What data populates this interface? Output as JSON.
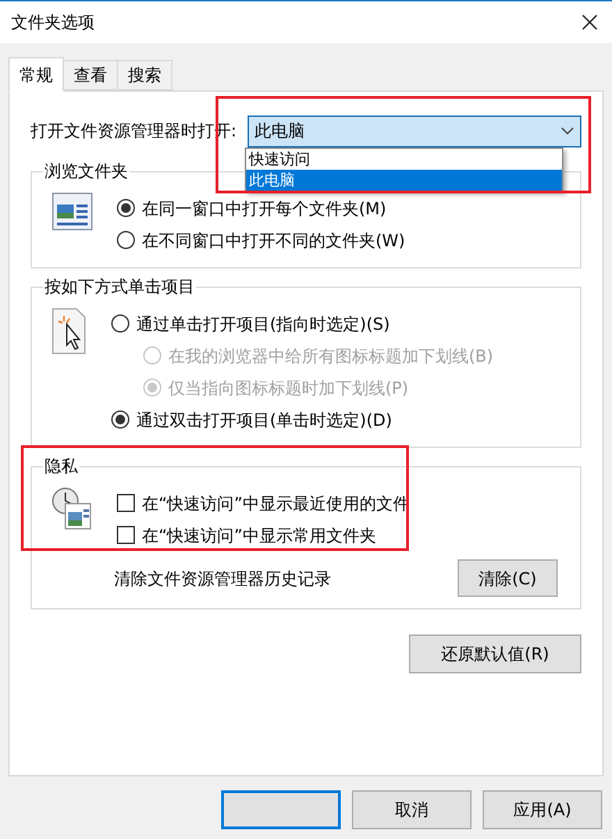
{
  "window": {
    "title": "文件夹选项"
  },
  "tabs": [
    {
      "label": "常规",
      "selected": true
    },
    {
      "label": "查看",
      "selected": false
    },
    {
      "label": "搜索",
      "selected": false
    }
  ],
  "open_in": {
    "label": "打开文件资源管理器时打开:",
    "value": "此电脑",
    "expanded": true,
    "highlighted": true,
    "options": [
      {
        "label": "快速访问",
        "selected": false
      },
      {
        "label": "此电脑",
        "selected": true
      }
    ]
  },
  "groups": [
    {
      "title": "浏览文件夹",
      "highlighted": false,
      "options": [
        {
          "kind": "radio",
          "label": "在同一窗口中打开每个文件夹(M)",
          "checked": true,
          "disabled": false,
          "indented": false
        },
        {
          "kind": "radio",
          "label": "在不同窗口中打开不同的文件夹(W)",
          "checked": false,
          "disabled": false,
          "indented": false
        }
      ]
    },
    {
      "title": "按如下方式单击项目",
      "highlighted": false,
      "options": [
        {
          "kind": "radio",
          "label": "通过单击打开项目(指向时选定)(S)",
          "checked": false,
          "disabled": false,
          "indented": false
        },
        {
          "kind": "radio",
          "label": "在我的浏览器中给所有图标标题加下划线(B)",
          "checked": false,
          "disabled": true,
          "indented": true
        },
        {
          "kind": "radio",
          "label": "仅当指向图标标题时加下划线(P)",
          "checked": true,
          "disabled": true,
          "indented": true
        },
        {
          "kind": "radio",
          "label": "通过双击打开项目(单击时选定)(D)",
          "checked": true,
          "disabled": false,
          "indented": false
        }
      ]
    },
    {
      "title": "隐私",
      "highlighted": true,
      "options": [
        {
          "kind": "checkbox",
          "label": "在“快速访问”中显示最近使用的文件",
          "checked": false,
          "disabled": false,
          "indented": false
        },
        {
          "kind": "checkbox",
          "label": "在“快速访问”中显示常用文件夹",
          "checked": false,
          "disabled": false,
          "indented": false
        }
      ],
      "action": {
        "label": "清除文件资源管理器历史记录",
        "button": "清除(C)"
      }
    }
  ],
  "restore_button": "还原默认值(R)",
  "footer_buttons": [
    {
      "focused": true
    },
    {
      "label": "取消",
      "focused": false
    },
    {
      "label": "应用(A)",
      "focused": false
    }
  ]
}
